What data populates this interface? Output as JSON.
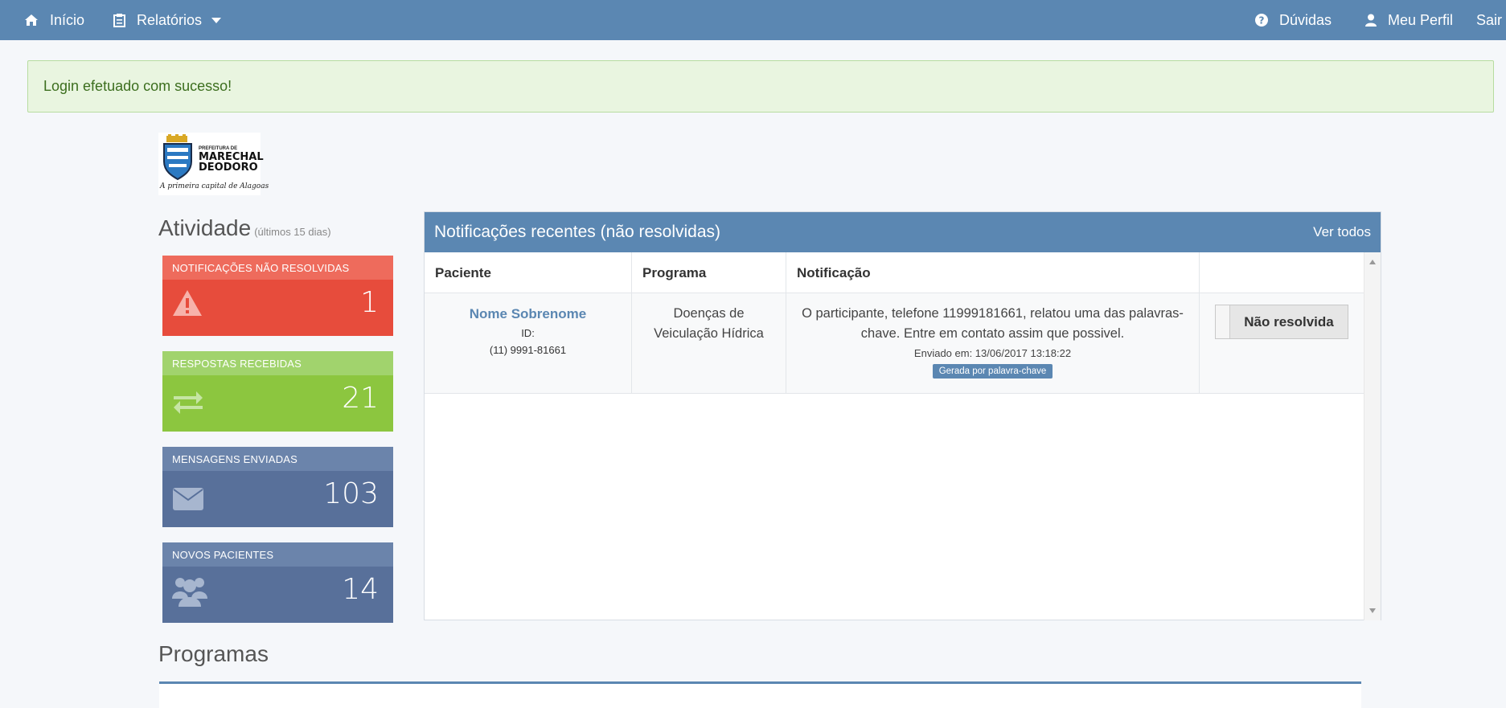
{
  "navbar": {
    "home_label": "Início",
    "reports_label": "Relatórios",
    "help_label": "Dúvidas",
    "profile_label": "Meu Perfil",
    "logout_label": "Sair"
  },
  "alert": {
    "message": "Login efetuado com sucesso!"
  },
  "logo": {
    "line1": "PREFEITURA DE",
    "line2": "MARECHAL",
    "line3": "DEODORO",
    "tagline": "A primeira capital de Alagoas"
  },
  "activity": {
    "title": "Atividade",
    "subtitle": "(últimos 15 dias)",
    "stats": [
      {
        "label": "NOTIFICAÇÕES NÃO RESOLVIDAS",
        "value": "1",
        "icon": "warning-icon",
        "color": "#e74c3c"
      },
      {
        "label": "RESPOSTAS RECEBIDAS",
        "value": "21",
        "icon": "exchange-icon",
        "color": "#8cc63f"
      },
      {
        "label": "MENSAGENS ENVIADAS",
        "value": "103",
        "icon": "envelope-icon",
        "color": "#58709a"
      },
      {
        "label": "NOVOS PACIENTES",
        "value": "14",
        "icon": "users-icon",
        "color": "#58709a"
      }
    ]
  },
  "notifications": {
    "title": "Notificações recentes (não resolvidas)",
    "see_all": "Ver todos",
    "columns": [
      "Paciente",
      "Programa",
      "Notificação",
      ""
    ],
    "rows": [
      {
        "patient_name": "Nome Sobrenome",
        "patient_id": "ID:",
        "patient_phone": "(11) 9991-81661",
        "program": "Doenças de Veiculação Hídrica",
        "notification": "O participante, telefone 11999181661, relatou uma das palavras-chave. Entre em contato assim que possivel.",
        "sent": "Enviado em: 13/06/2017 13:18:22",
        "badge": "Gerada por palavra-chave",
        "action": "Não resolvida"
      }
    ]
  },
  "programs": {
    "title": "Programas"
  },
  "colors": {
    "primary": "#5b87b2",
    "danger": "#e74c3c",
    "success": "#8cc63f",
    "muted_blue": "#58709a"
  }
}
